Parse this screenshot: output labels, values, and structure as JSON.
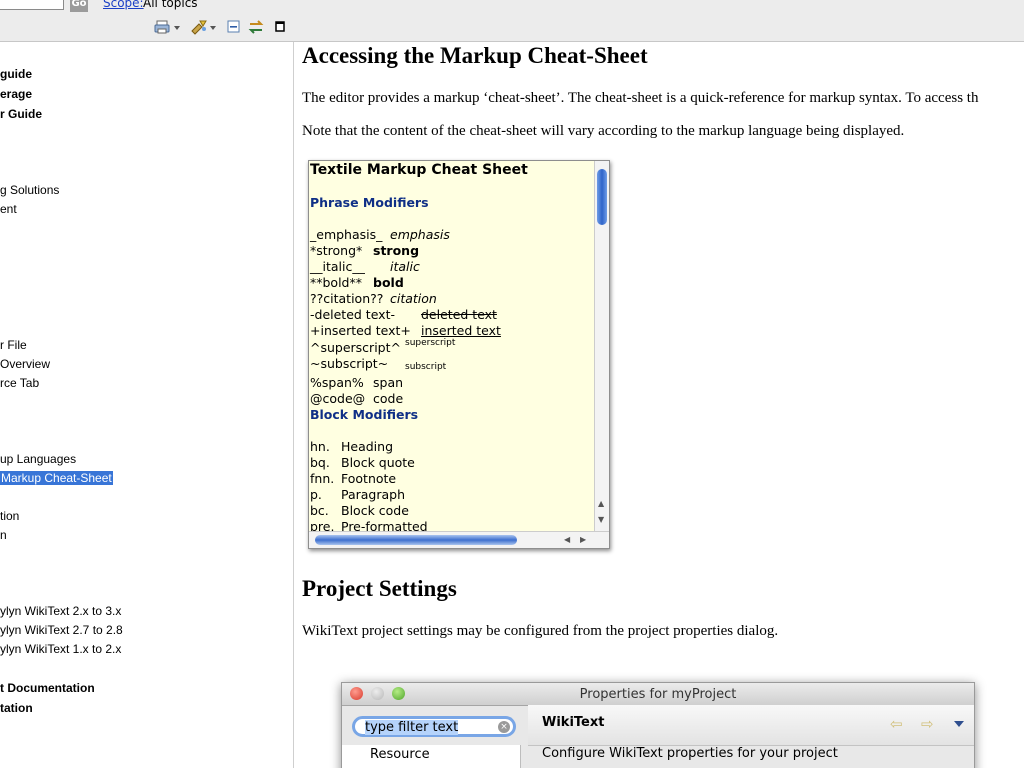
{
  "search": {
    "go_label": "Go",
    "scope_link": "Scope:",
    "scope_value": "All topics"
  },
  "nav": {
    "items": [
      {
        "label": "guide",
        "bold": true
      },
      {
        "label": "erage",
        "bold": true
      },
      {
        "label": "r Guide",
        "bold": true
      },
      {
        "label": "g Solutions",
        "bold": false
      },
      {
        "label": "ent",
        "bold": false
      },
      {
        "label": "r File",
        "bold": false
      },
      {
        "label": "Overview",
        "bold": false
      },
      {
        "label": "rce Tab",
        "bold": false
      },
      {
        "label": "up Languages",
        "bold": false
      },
      {
        "label": "Markup Cheat-Sheet",
        "bold": false,
        "selected": true
      },
      {
        "label": "tion",
        "bold": false
      },
      {
        "label": "n",
        "bold": false
      },
      {
        "label": "ylyn WikiText 2.x to 3.x",
        "bold": false
      },
      {
        "label": "ylyn WikiText 2.7 to 2.8",
        "bold": false
      },
      {
        "label": "ylyn WikiText 1.x to 2.x",
        "bold": false
      },
      {
        "label": "t Documentation",
        "bold": true
      },
      {
        "label": "tation",
        "bold": true
      }
    ]
  },
  "content": {
    "heading1": "Accessing the Markup Cheat-Sheet",
    "para1": "The editor provides a markup ‘cheat-sheet’. The cheat-sheet is a quick-reference for markup syntax. To access th",
    "para2": "Note that the content of the cheat-sheet will vary according to the markup language being displayed.",
    "heading2": "Project Settings",
    "para3": "WikiText project settings may be configured from the project properties dialog."
  },
  "cheatsheet": {
    "title": "Textile Markup Cheat Sheet",
    "phrase_header": "Phrase Modifiers",
    "phrase_rows": [
      {
        "markup": "_emphasis_",
        "result": "emphasis",
        "style": "italic"
      },
      {
        "markup": "*strong*",
        "result": "strong",
        "style": "bold"
      },
      {
        "markup": "__italic__",
        "result": "italic",
        "style": "italic"
      },
      {
        "markup": "**bold**",
        "result": "bold",
        "style": "bold"
      },
      {
        "markup": "??citation??",
        "result": "citation",
        "style": "italic"
      },
      {
        "markup": "-deleted text-",
        "result": "deleted text",
        "style": "strike"
      },
      {
        "markup": "+inserted text+",
        "result": "inserted text",
        "style": "underline"
      },
      {
        "markup": "^superscript^",
        "result": "superscript",
        "style": "sup"
      },
      {
        "markup": "~subscript~",
        "result": "subscript",
        "style": "sub"
      },
      {
        "markup": "%span%",
        "result": "span",
        "style": "normal"
      },
      {
        "markup": "@code@",
        "result": "code",
        "style": "normal"
      }
    ],
    "block_header": "Block Modifiers",
    "block_rows": [
      {
        "markup": "hn.",
        "result": "Heading"
      },
      {
        "markup": "bq.",
        "result": "Block quote"
      },
      {
        "markup": "fnn.",
        "result": "Footnote"
      },
      {
        "markup": "p.",
        "result": "Paragraph"
      },
      {
        "markup": "bc.",
        "result": "Block code"
      },
      {
        "markup": "pre.",
        "result": "Pre-formatted"
      }
    ]
  },
  "dialog": {
    "title": "Properties for myProject",
    "filter_placeholder": "type filter text",
    "tree_item": "Resource",
    "page_title": "WikiText",
    "description": "Configure WikiText properties for your project"
  },
  "colors": {
    "link": "#1a3fc6",
    "selection": "#3875d7",
    "cheat_bg": "#ffffe1",
    "section_blue": "#0f2f86"
  }
}
